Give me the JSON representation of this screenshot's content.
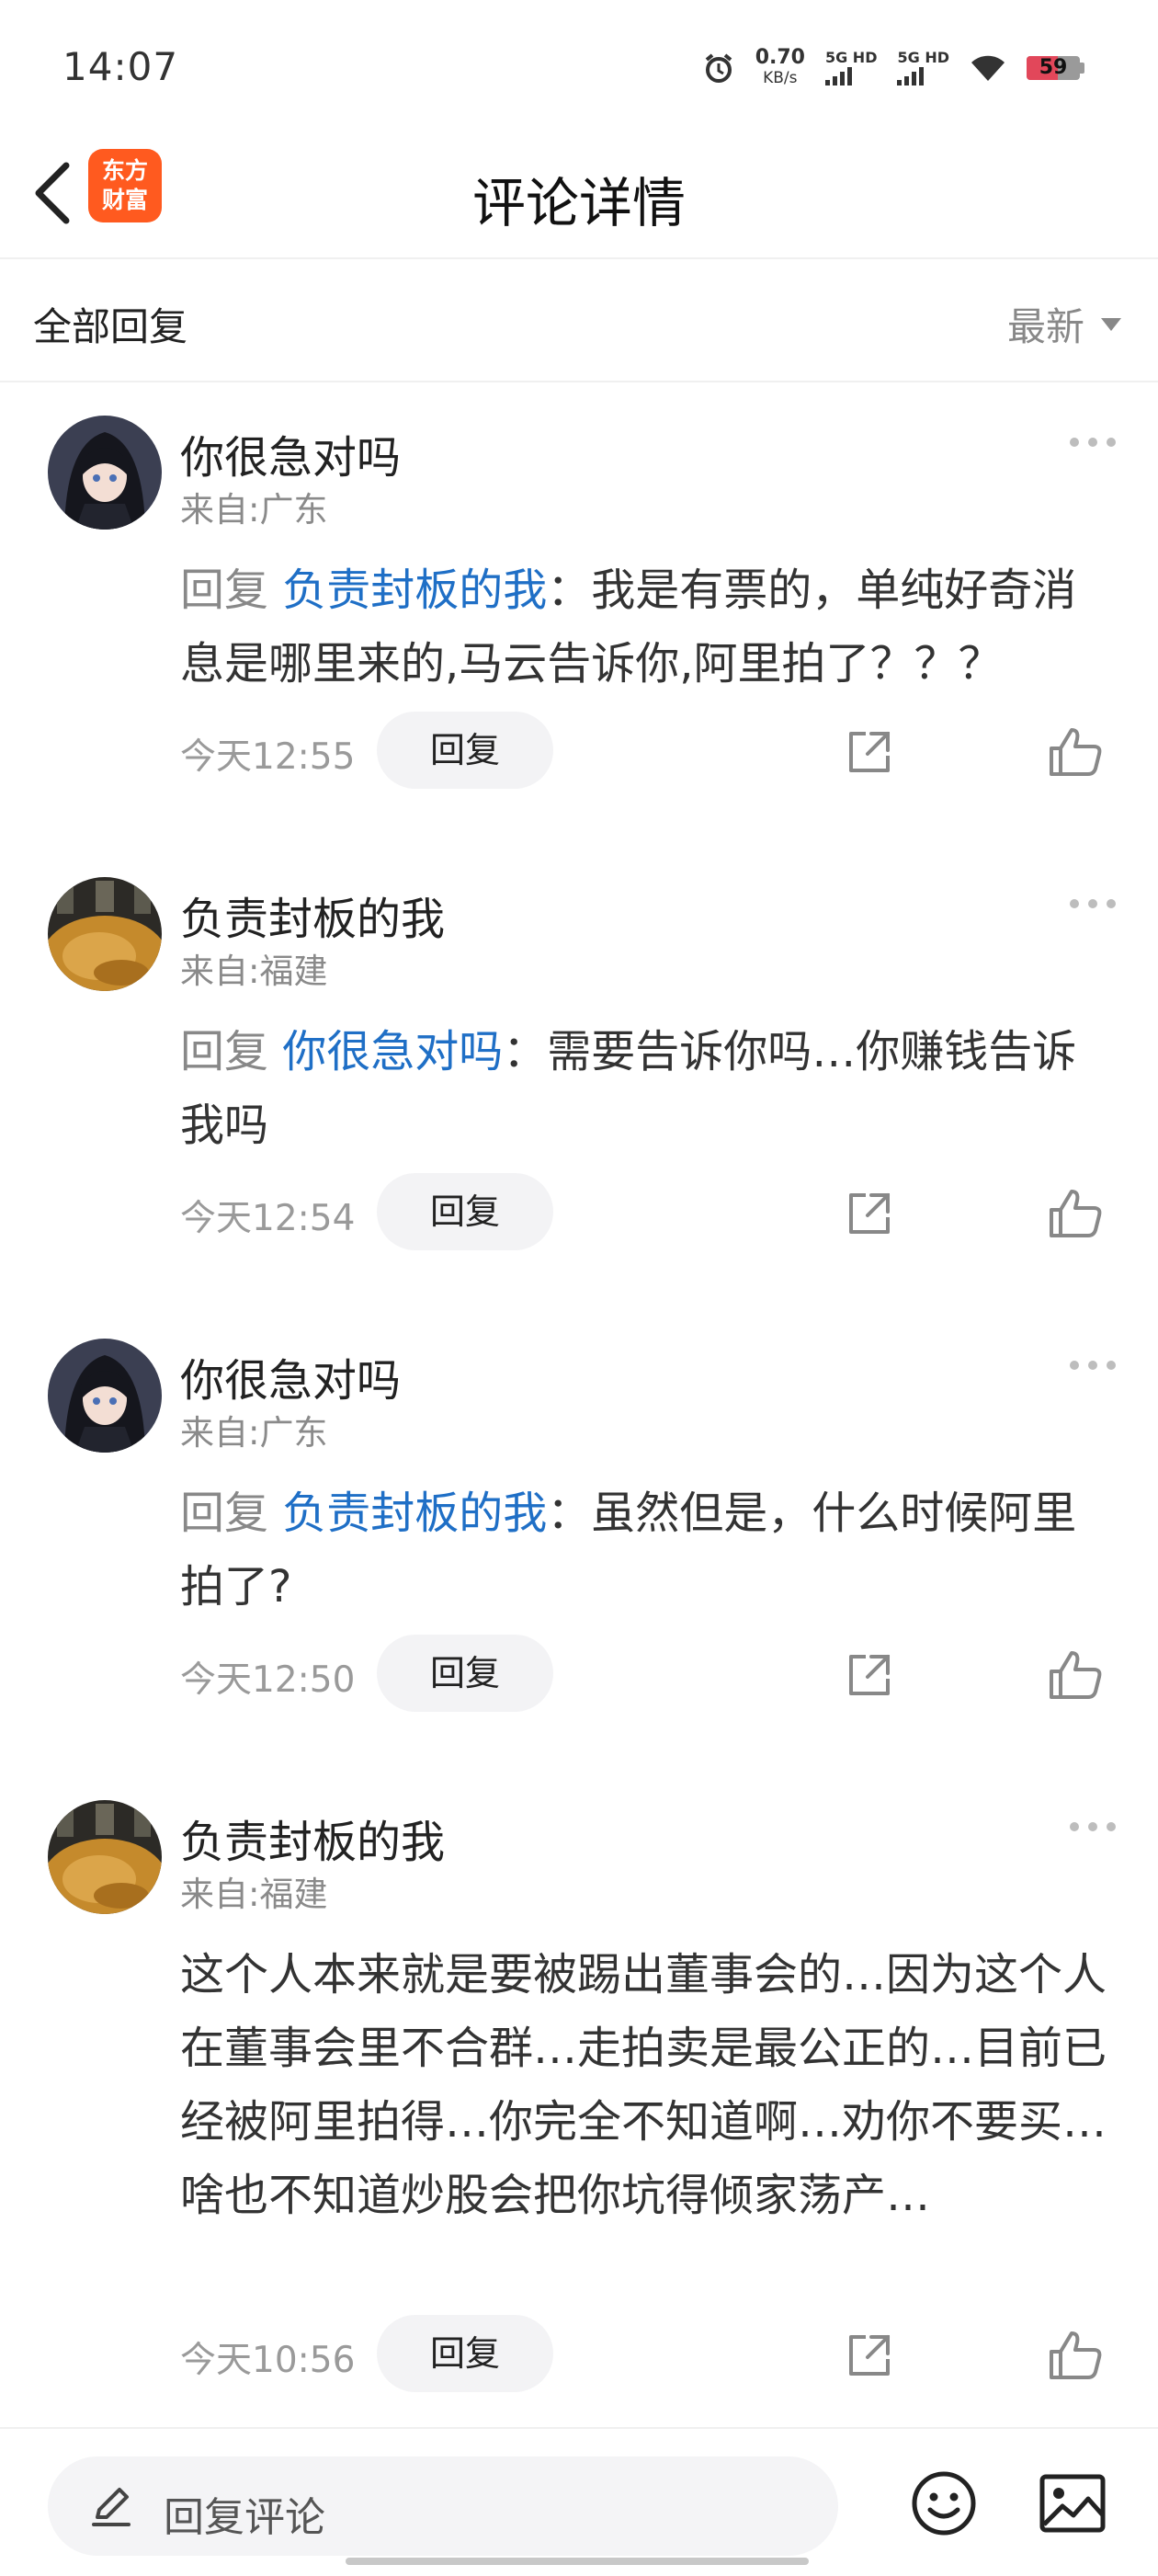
{
  "status_bar": {
    "time": "14:07",
    "net_speed": "0.70",
    "net_unit": "KB/s",
    "sim1_label": "5G HD",
    "sim2_label": "5G HD",
    "battery": "59",
    "battery_level": 0.59
  },
  "header": {
    "title": "评论详情",
    "logo_line1": "东方",
    "logo_line2": "财富",
    "brand_color": "#ff5a1f"
  },
  "filter": {
    "label": "全部回复",
    "sort_label": "最新"
  },
  "comments": [
    {
      "user": "你很急对吗",
      "location": "来自:广东",
      "reply_prefix": "回复",
      "mention": "负责封板的我",
      "text": "：我是有票的，单纯好奇消息是哪里来的,马云告诉你,阿里拍了？？？",
      "time": "今天12:55",
      "reply_button": "回复"
    },
    {
      "user": "负责封板的我",
      "location": "来自:福建",
      "reply_prefix": "回复",
      "mention": "你很急对吗",
      "text": "：需要告诉你吗…你赚钱告诉我吗",
      "time": "今天12:54",
      "reply_button": "回复"
    },
    {
      "user": "你很急对吗",
      "location": "来自:广东",
      "reply_prefix": "回复",
      "mention": "负责封板的我",
      "text": "：虽然但是，什么时候阿里拍了?",
      "time": "今天12:50",
      "reply_button": "回复"
    },
    {
      "user": "负责封板的我",
      "location": "来自:福建",
      "text": "这个人本来就是要被踢出董事会的…因为这个人在董事会里不合群…走拍卖是最公正的…目前已经被阿里拍得…你完全不知道啊…劝你不要买…啥也不知道炒股会把你坑得倾家荡产…",
      "time": "今天10:56",
      "reply_button": "回复"
    }
  ],
  "bottom": {
    "input_placeholder": "回复评论"
  },
  "colors": {
    "mention": "#1f6fc6",
    "muted": "#888888"
  }
}
